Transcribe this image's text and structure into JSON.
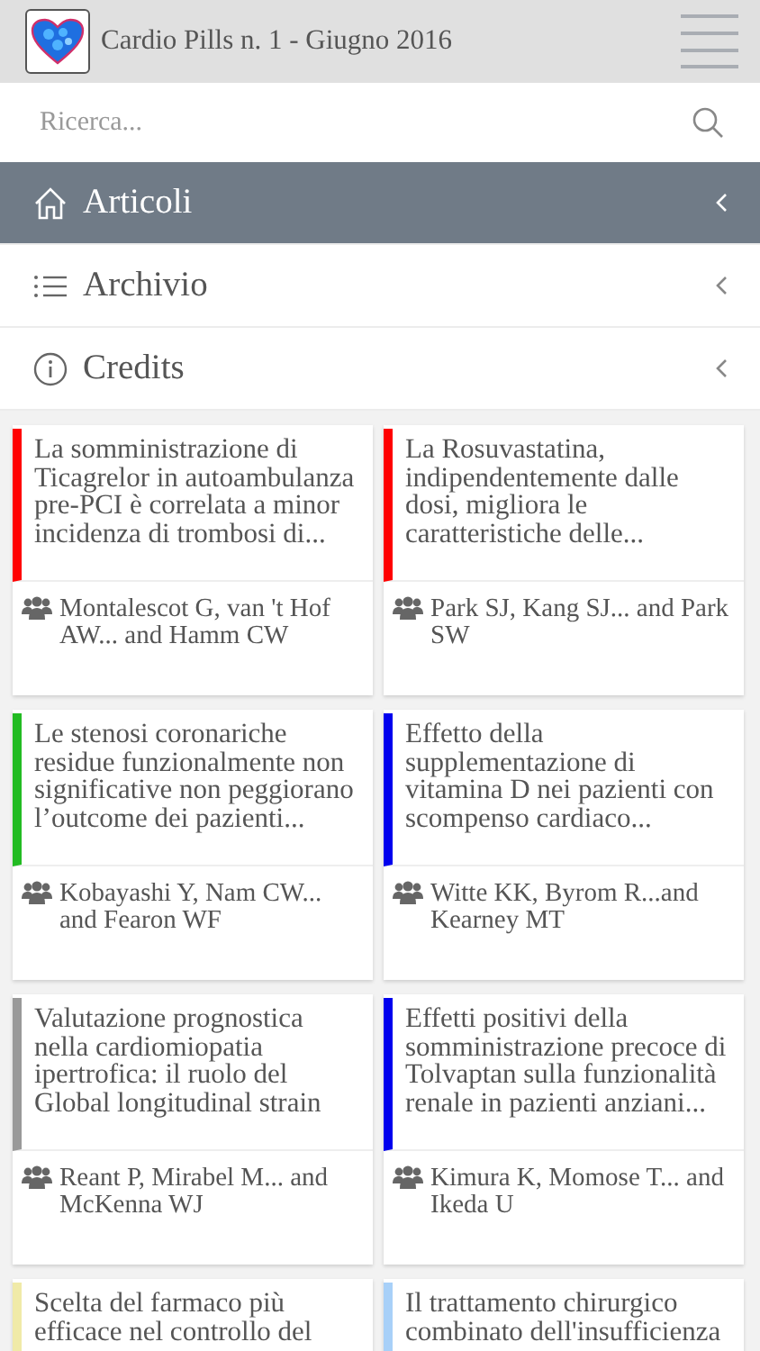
{
  "header": {
    "title": "Cardio Pills n. 1 - Giugno 2016"
  },
  "search": {
    "placeholder": "Ricerca..."
  },
  "menu": [
    {
      "kind": "home",
      "label": "Articoli",
      "selected": true
    },
    {
      "kind": "list",
      "label": "Archivio",
      "selected": false
    },
    {
      "kind": "info",
      "label": "Credits",
      "selected": false
    }
  ],
  "articles": [
    {
      "title": "La somministrazione di Ticagrelor in autoambulanza pre-PCI è correlata a minor incidenza di trombosi di...",
      "authors": "Montalescot G, van 't Hof AW... and Hamm CW",
      "color": "#ff0000"
    },
    {
      "title": "La Rosuvastatina, indipendentemente dalle dosi, migliora le caratteristiche delle...",
      "authors": "Park SJ, Kang SJ... and Park SW",
      "color": "#ff0000"
    },
    {
      "title": "Le stenosi coronariche residue funzionalmente non significative non peggiorano l’outcome dei pazienti...",
      "authors": "Kobayashi Y, Nam CW... and Fearon WF",
      "color": "#22bb22"
    },
    {
      "title": "Effetto della supplementazione di vitamina D nei pazienti con scompenso cardiaco...",
      "authors": "Witte KK, Byrom R...and Kearney MT",
      "color": "#0000ee"
    },
    {
      "title": "Valutazione prognostica nella cardiomiopatia ipertrofica: il ruolo del Global longitudinal strain",
      "authors": "Reant P, Mirabel M... and McKenna WJ",
      "color": "#999999"
    },
    {
      "title": "Effetti positivi della somministrazione precoce di Tolvaptan sulla funzionalità renale in pazienti anziani...",
      "authors": "Kimura K, Momose T... and Ikeda U",
      "color": "#0000ee"
    },
    {
      "title": "Scelta del farmaco più efficace nel controllo del",
      "color": "#f0eaa8"
    },
    {
      "title": "Il trattamento chirurgico combinato dell'insufficienza",
      "color": "#a8d0f8"
    }
  ]
}
